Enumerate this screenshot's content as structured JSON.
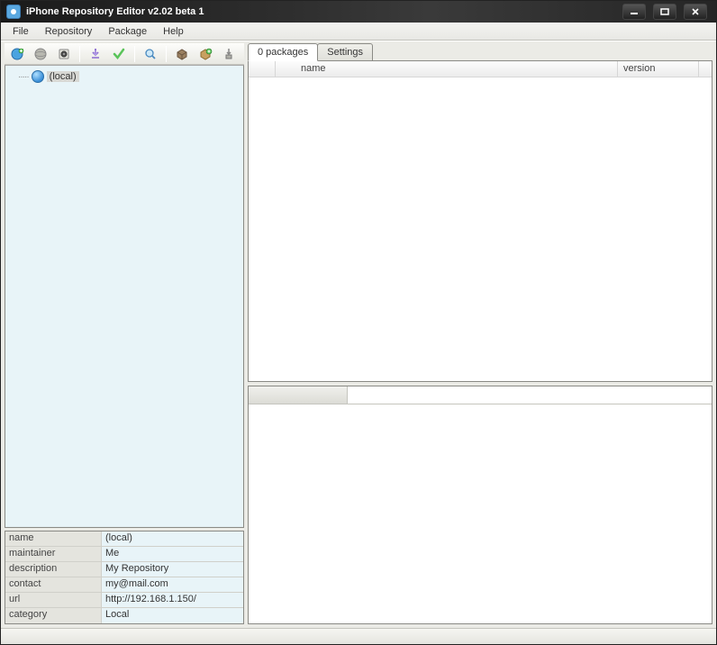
{
  "titlebar": {
    "title": "iPhone Repository Editor v2.02 beta 1"
  },
  "menu": {
    "file": "File",
    "repository": "Repository",
    "package": "Package",
    "help": "Help"
  },
  "toolbar_icons": {
    "new_repo": "new-repo",
    "open_repo": "open-repo",
    "save": "save",
    "download": "download",
    "verify": "verify",
    "search": "search",
    "pkg1": "package-a",
    "pkg2": "package-b",
    "export": "export"
  },
  "tree": {
    "root_label": "(local)"
  },
  "properties": [
    {
      "key": "name",
      "val": "(local)"
    },
    {
      "key": "maintainer",
      "val": "Me"
    },
    {
      "key": "description",
      "val": "My Repository"
    },
    {
      "key": "contact",
      "val": "my@mail.com"
    },
    {
      "key": "url",
      "val": "http://192.168.1.150/"
    },
    {
      "key": "category",
      "val": "Local"
    }
  ],
  "tabs": {
    "packages": "0 packages",
    "settings": "Settings"
  },
  "list_columns": {
    "name": "name",
    "version": "version"
  }
}
